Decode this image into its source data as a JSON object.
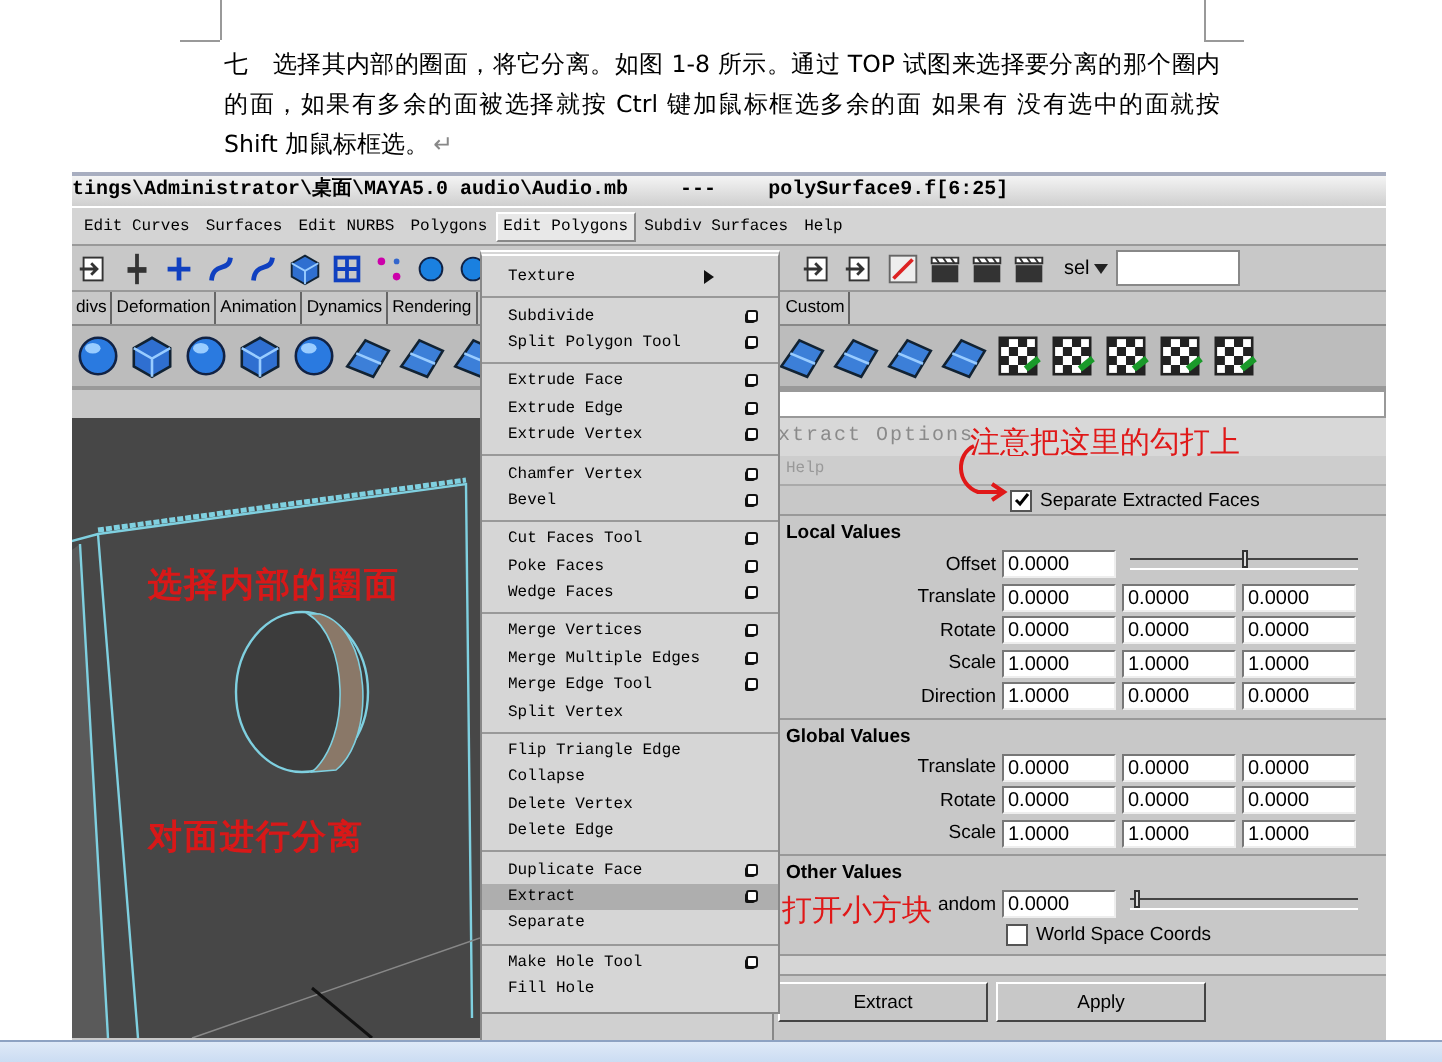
{
  "document": {
    "paragraph": "七　选择其内部的圈面，将它分离。如图 1-8 所示。通过 TOP 试图来选择要分离的那个圈内的面，如果有多余的面被选择就按 Ctrl 键加鼠标框选多余的面 如果有 没有选中的面就按 Shift 加鼠标框选。",
    "paragraph_mark": "↵"
  },
  "maya": {
    "title": {
      "path": "tings\\Administrator\\桌面\\MAYA5.0 audio\\Audio.mb",
      "separator": "---",
      "selection": "polySurface9.f[6:25]"
    },
    "menus": [
      {
        "label": "Edit Curves",
        "selected": false
      },
      {
        "label": "Surfaces",
        "selected": false
      },
      {
        "label": "Edit NURBS",
        "selected": false
      },
      {
        "label": "Polygons",
        "selected": false
      },
      {
        "label": "Edit Polygons",
        "selected": true
      },
      {
        "label": "Subdiv Surfaces",
        "selected": false
      },
      {
        "label": "Help",
        "selected": false
      }
    ],
    "selection_mode": "sel",
    "shelf_tabs": [
      {
        "label": "divs",
        "selected": false
      },
      {
        "label": "Deformation",
        "selected": false
      },
      {
        "label": "Animation",
        "selected": false
      },
      {
        "label": "Dynamics",
        "selected": false
      },
      {
        "label": "Rendering",
        "selected": false
      },
      {
        "label": "Custom",
        "selected": false
      }
    ],
    "viewport": {
      "annotations": [
        "选择内部的圈面",
        "对面进行分离"
      ]
    },
    "dropdown": {
      "groups": [
        [
          {
            "label": "Texture",
            "kind": "submenu",
            "selected": false
          }
        ],
        [
          {
            "label": "Subdivide",
            "kind": "option",
            "selected": false
          },
          {
            "label": "Split Polygon Tool",
            "kind": "option",
            "selected": false
          }
        ],
        [
          {
            "label": "Extrude Face",
            "kind": "option",
            "selected": false
          },
          {
            "label": "Extrude Edge",
            "kind": "option",
            "selected": false
          },
          {
            "label": "Extrude Vertex",
            "kind": "option",
            "selected": false
          }
        ],
        [
          {
            "label": "Chamfer Vertex",
            "kind": "option",
            "selected": false
          },
          {
            "label": "Bevel",
            "kind": "option",
            "selected": false
          }
        ],
        [
          {
            "label": "Cut Faces Tool",
            "kind": "option",
            "selected": false
          },
          {
            "label": "Poke Faces",
            "kind": "option",
            "selected": false
          },
          {
            "label": "Wedge Faces",
            "kind": "option",
            "selected": false
          }
        ],
        [
          {
            "label": "Merge Vertices",
            "kind": "option",
            "selected": false
          },
          {
            "label": "Merge Multiple Edges",
            "kind": "option",
            "selected": false
          },
          {
            "label": "Merge Edge Tool",
            "kind": "option",
            "selected": false
          },
          {
            "label": "Split Vertex",
            "kind": "plain",
            "selected": false
          }
        ],
        [
          {
            "label": "Flip Triangle Edge",
            "kind": "plain",
            "selected": false
          },
          {
            "label": "Collapse",
            "kind": "plain",
            "selected": false
          },
          {
            "label": "Delete Vertex",
            "kind": "plain",
            "selected": false
          },
          {
            "label": "Delete Edge",
            "kind": "plain",
            "selected": false
          }
        ],
        [
          {
            "label": "Duplicate Face",
            "kind": "option",
            "selected": false
          },
          {
            "label": "Extract",
            "kind": "option",
            "selected": true
          },
          {
            "label": "Separate",
            "kind": "plain",
            "selected": false
          }
        ],
        [
          {
            "label": "Make Hole Tool",
            "kind": "option",
            "selected": false
          },
          {
            "label": "Fill Hole",
            "kind": "plain",
            "selected": false
          }
        ]
      ]
    },
    "options": {
      "title": "xtract Options",
      "menus": [
        "Help"
      ],
      "separate_checkbox": {
        "label": "Separate Extracted Faces",
        "checked": true
      },
      "sections": [
        {
          "title": "Local Values",
          "rows": [
            {
              "kind": "slider",
              "label": "Offset",
              "values": [
                "0.0000"
              ],
              "level": 0.5
            },
            {
              "kind": "vector",
              "label": "Translate",
              "values": [
                "0.0000",
                "0.0000",
                "0.0000"
              ]
            },
            {
              "kind": "vector",
              "label": "Rotate",
              "values": [
                "0.0000",
                "0.0000",
                "0.0000"
              ]
            },
            {
              "kind": "vector",
              "label": "Scale",
              "values": [
                "1.0000",
                "1.0000",
                "1.0000"
              ]
            },
            {
              "kind": "vector",
              "label": "Direction",
              "values": [
                "1.0000",
                "0.0000",
                "0.0000"
              ]
            }
          ]
        },
        {
          "title": "Global Values",
          "rows": [
            {
              "kind": "vector",
              "label": "Translate",
              "values": [
                "0.0000",
                "0.0000",
                "0.0000"
              ]
            },
            {
              "kind": "vector",
              "label": "Rotate",
              "values": [
                "0.0000",
                "0.0000",
                "0.0000"
              ]
            },
            {
              "kind": "vector",
              "label": "Scale",
              "values": [
                "1.0000",
                "1.0000",
                "1.0000"
              ]
            }
          ]
        },
        {
          "title": "Other Values",
          "rows": [
            {
              "kind": "slider",
              "label": "andom",
              "values": [
                "0.0000"
              ],
              "level": 0.02
            },
            {
              "kind": "checkbox",
              "label": "World Space Coords",
              "checked": false
            }
          ]
        }
      ],
      "buttons": [
        "Extract",
        "Apply"
      ]
    },
    "annotations": {
      "checkbox_note": "注意把这里的勾打上",
      "option_box_note": "打开小方块"
    }
  }
}
